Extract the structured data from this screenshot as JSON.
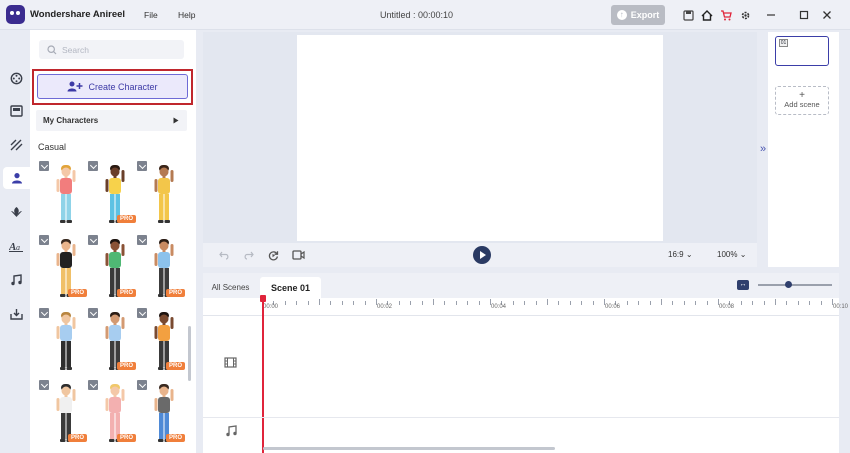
{
  "app": {
    "name": "Wondershare Anireel",
    "document_title": "Untitled : 00:00:10"
  },
  "menu": [
    {
      "label": "File"
    },
    {
      "label": "Help"
    }
  ],
  "toolbar": {
    "export_label": "Export"
  },
  "panel": {
    "search_placeholder": "Search",
    "create_label": "Create Character",
    "my_characters_label": "My Characters",
    "section_label": "Casual",
    "pro_label": "PRO",
    "characters": [
      {
        "pro": false,
        "skin": "#f4c8a8",
        "hair": "#e2a43a",
        "top": "#f27d7d",
        "bottom": "#8fd3e8"
      },
      {
        "pro": true,
        "skin": "#6a3f2a",
        "hair": "#2a1a12",
        "top": "#f7d24b",
        "bottom": "#5ec2e3"
      },
      {
        "pro": false,
        "skin": "#b47a52",
        "hair": "#3a2418",
        "top": "#f3c64a",
        "bottom": "#f3c64a"
      },
      {
        "pro": true,
        "skin": "#e9b48c",
        "hair": "#3a2a20",
        "top": "#222222",
        "bottom": "#f0c068"
      },
      {
        "pro": true,
        "skin": "#8a5236",
        "hair": "#1e1410",
        "top": "#4fb874",
        "bottom": "#3a3a3a"
      },
      {
        "pro": true,
        "skin": "#c98b62",
        "hair": "#2b1d15",
        "top": "#8cc2ec",
        "bottom": "#3c3c3c"
      },
      {
        "pro": false,
        "skin": "#f0c6a0",
        "hair": "#b8853f",
        "top": "#a7cdf0",
        "bottom": "#2f2f2f"
      },
      {
        "pro": true,
        "skin": "#d39a72",
        "hair": "#2b1d15",
        "top": "#a7cdf0",
        "bottom": "#3c3c3c"
      },
      {
        "pro": true,
        "skin": "#7a4a30",
        "hair": "#1e1410",
        "top": "#f3a040",
        "bottom": "#3a3a3a"
      },
      {
        "pro": true,
        "skin": "#f0c6a0",
        "hair": "#2e2e2e",
        "top": "#f0f0f0",
        "bottom": "#3a3a3a"
      },
      {
        "pro": true,
        "skin": "#f4c8a8",
        "hair": "#f0c86a",
        "top": "#f3b0b0",
        "bottom": "#f3b0b0"
      },
      {
        "pro": true,
        "skin": "#e9b48c",
        "hair": "#3a2a20",
        "top": "#6a6a6a",
        "bottom": "#4f8ad6"
      }
    ]
  },
  "stage": {
    "ratio": "16:9",
    "zoom": "100%"
  },
  "scenes": {
    "thumb_number": "01",
    "add_label": "Add scene"
  },
  "timeline": {
    "tabs": [
      {
        "label": "All Scenes"
      },
      {
        "label": "Scene 01"
      }
    ],
    "time_labels": [
      "00:00",
      "00:02",
      "00:04",
      "00:06",
      "00:08",
      "00:10"
    ]
  },
  "colors": {
    "accent": "#3b3ea8",
    "highlight": "#c0272d",
    "pro_badge": "#f07f3b",
    "playhead": "#e0243b"
  },
  "icons": {
    "rail": [
      "film-reel-icon",
      "scene-icon",
      "background-icon",
      "character-icon",
      "effects-icon",
      "text-icon",
      "music-icon",
      "import-icon"
    ],
    "titlebar": [
      "save-icon",
      "home-icon",
      "cart-icon",
      "settings-icon"
    ]
  }
}
